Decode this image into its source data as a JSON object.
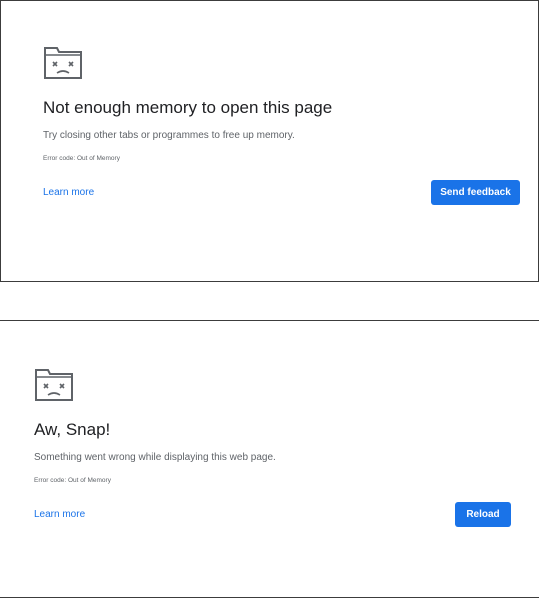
{
  "memory_error": {
    "icon": "sad-tab-icon",
    "title": "Not enough memory to open this page",
    "description": "Try closing other tabs or programmes to free up memory.",
    "error_code": "Error code: Out of Memory",
    "learn_more": "Learn more",
    "primary_button": "Send feedback"
  },
  "snap_error": {
    "icon": "sad-tab-icon",
    "title": "Aw, Snap!",
    "description": "Something went wrong while displaying this web page.",
    "error_code": "Error code: Out of Memory",
    "learn_more": "Learn more",
    "primary_button": "Reload"
  },
  "colors": {
    "accent": "#1a73e8",
    "title_text": "#202124",
    "secondary_text": "#5f6368",
    "icon_stroke": "#5f6368"
  }
}
